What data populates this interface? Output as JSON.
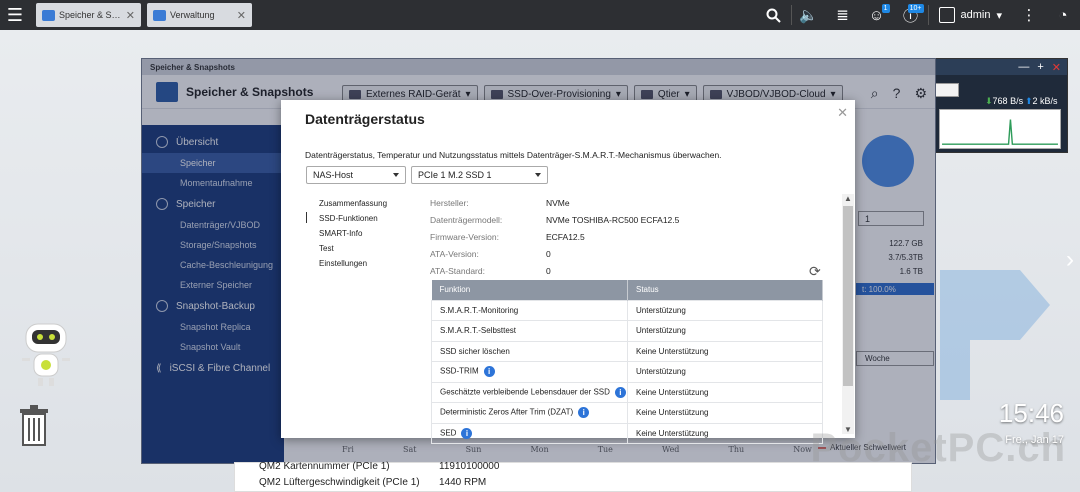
{
  "taskbar": {
    "tabs": [
      {
        "label": "Speicher & Snapshots"
      },
      {
        "label": "Verwaltung"
      }
    ],
    "notification_badge": "1",
    "info_badge": "10+",
    "user": "admin"
  },
  "monitor": {
    "down_rate": "768 B/s",
    "up_rate": "2 kB/s"
  },
  "app": {
    "window_title": "Speicher & Snapshots",
    "title": "Speicher & Snapshots",
    "tools": [
      {
        "label": "Externes RAID-Gerät"
      },
      {
        "label": "SSD-Over-Provisioning"
      },
      {
        "label": "Qtier"
      },
      {
        "label": "VJBOD/VJBOD-Cloud"
      }
    ],
    "sidebar": {
      "groups": [
        {
          "label": "Übersicht",
          "items": [
            "Speicher",
            "Momentaufnahme"
          ]
        },
        {
          "label": "Speicher",
          "items": [
            "Datenträger/VJBOD",
            "Storage/Snapshots",
            "Cache-Beschleunigung",
            "Externer Speicher"
          ]
        },
        {
          "label": "Snapshot-Backup",
          "items": [
            "Snapshot Replica",
            "Snapshot Vault"
          ]
        },
        {
          "label": "iSCSI & Fibre Channel",
          "items": []
        }
      ]
    },
    "right": {
      "select1": "1",
      "values": [
        "122.7 GB",
        "3.7/5.3TB",
        "1.6 TB"
      ],
      "bar_label": "t: 100.0%",
      "select2": "Woche"
    },
    "days": [
      "Fri",
      "Sat",
      "Sun",
      "Mon",
      "Tue",
      "Wed",
      "Thu",
      "Now"
    ],
    "legend": "Aktueller Schwellwert"
  },
  "bottom": {
    "row1_label": "QM2 Kartennummer (PCIe 1)",
    "row1_value": "11910100000",
    "row2_label": "QM2 Lüftergeschwindigkeit (PCIe 1)",
    "row2_value": "1440 RPM"
  },
  "modal": {
    "title": "Datenträgerstatus",
    "description": "Datenträgerstatus, Temperatur und Nutzungsstatus mittels Datenträger-S.M.A.R.T.-Mechanismus überwachen.",
    "host_select": "NAS-Host",
    "disk_select": "PCIe 1 M.2 SSD 1",
    "nav": [
      "Zusammenfassung",
      "SSD-Funktionen",
      "SMART-Info",
      "Test",
      "Einstellungen"
    ],
    "info": [
      {
        "label": "Hersteller:",
        "value": "NVMe"
      },
      {
        "label": "Datenträgermodell:",
        "value": "NVMe TOSHIBA-RC500 ECFA12.5"
      },
      {
        "label": "Firmware-Version:",
        "value": "ECFA12.5"
      },
      {
        "label": "ATA-Version:",
        "value": "0"
      },
      {
        "label": "ATA-Standard:",
        "value": "0"
      }
    ],
    "table": {
      "headers": [
        "Funktion",
        "Status"
      ],
      "rows": [
        {
          "f": "S.M.A.R.T.-Monitoring",
          "s": "Unterstützung",
          "info": false
        },
        {
          "f": "S.M.A.R.T.-Selbsttest",
          "s": "Unterstützung",
          "info": false
        },
        {
          "f": "SSD sicher löschen",
          "s": "Keine Unterstützung",
          "info": false
        },
        {
          "f": "SSD-TRIM",
          "s": "Unterstützung",
          "info": true
        },
        {
          "f": "Geschätzte verbleibende Lebensdauer der SSD",
          "s": "Keine Unterstützung",
          "info": true
        },
        {
          "f": "Deterministic Zeros After Trim (DZAT)",
          "s": "Keine Unterstützung",
          "info": true
        },
        {
          "f": "SED",
          "s": "Keine Unterstützung",
          "info": true
        }
      ]
    }
  },
  "clock": {
    "time": "15:46",
    "date": "Fre., Jan 17"
  },
  "watermark": "PocketPC.ch"
}
